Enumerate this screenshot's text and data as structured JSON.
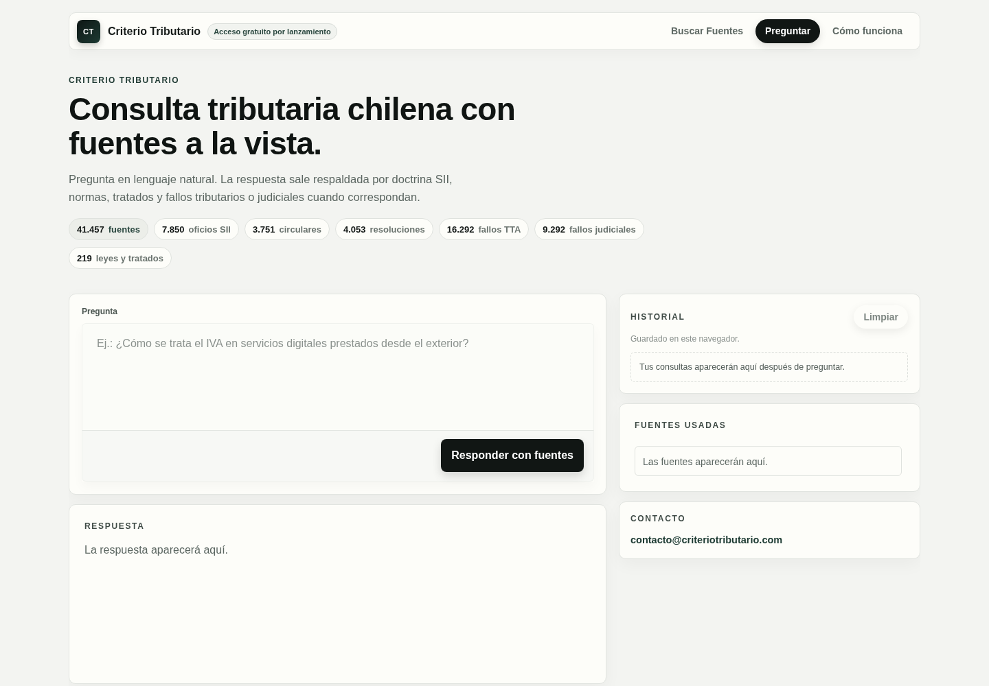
{
  "header": {
    "logo": "CT",
    "brand": "Criterio Tributario",
    "badge": "Acceso gratuito por lanzamiento",
    "nav": [
      {
        "label": "Buscar Fuentes",
        "selected": false
      },
      {
        "label": "Preguntar",
        "selected": true
      },
      {
        "label": "Cómo funciona",
        "selected": false
      }
    ]
  },
  "hero": {
    "eyebrow": "CRITERIO TRIBUTARIO",
    "title": "Consulta tributaria chilena con fuentes a la vista.",
    "subtitle": "Pregunta en lenguaje natural. La respuesta sale respaldada por doctrina SII, normas, tratados y fallos tributarios o judiciales cuando correspondan.",
    "stats": [
      {
        "kind": "total",
        "count": "41.457",
        "label": "fuentes"
      },
      {
        "kind": "category",
        "count": "7.850",
        "label": "oficios SII"
      },
      {
        "kind": "category",
        "count": "3.751",
        "label": "circulares"
      },
      {
        "kind": "category",
        "count": "4.053",
        "label": "resoluciones"
      },
      {
        "kind": "category",
        "count": "16.292",
        "label": "fallos TTA"
      },
      {
        "kind": "category",
        "count": "9.292",
        "label": "fallos judiciales"
      },
      {
        "kind": "category",
        "count": "219",
        "label": "leyes y tratados"
      }
    ]
  },
  "question": {
    "label": "Pregunta",
    "placeholder": "Ej.: ¿Cómo se trata el IVA en servicios digitales prestados desde el exterior?",
    "submit": "Responder con fuentes"
  },
  "answer": {
    "heading": "RESPUESTA",
    "text": "La respuesta aparecerá aquí."
  },
  "history": {
    "heading": "HISTORIAL",
    "clear": "Limpiar",
    "note": "Guardado en este navegador.",
    "empty": "Tus consultas aparecerán aquí después de preguntar."
  },
  "sources": {
    "heading": "FUENTES USADAS",
    "empty": "Las fuentes aparecerán aquí."
  },
  "contact": {
    "heading": "CONTACTO",
    "email": "contacto@criteriotributario.com"
  }
}
